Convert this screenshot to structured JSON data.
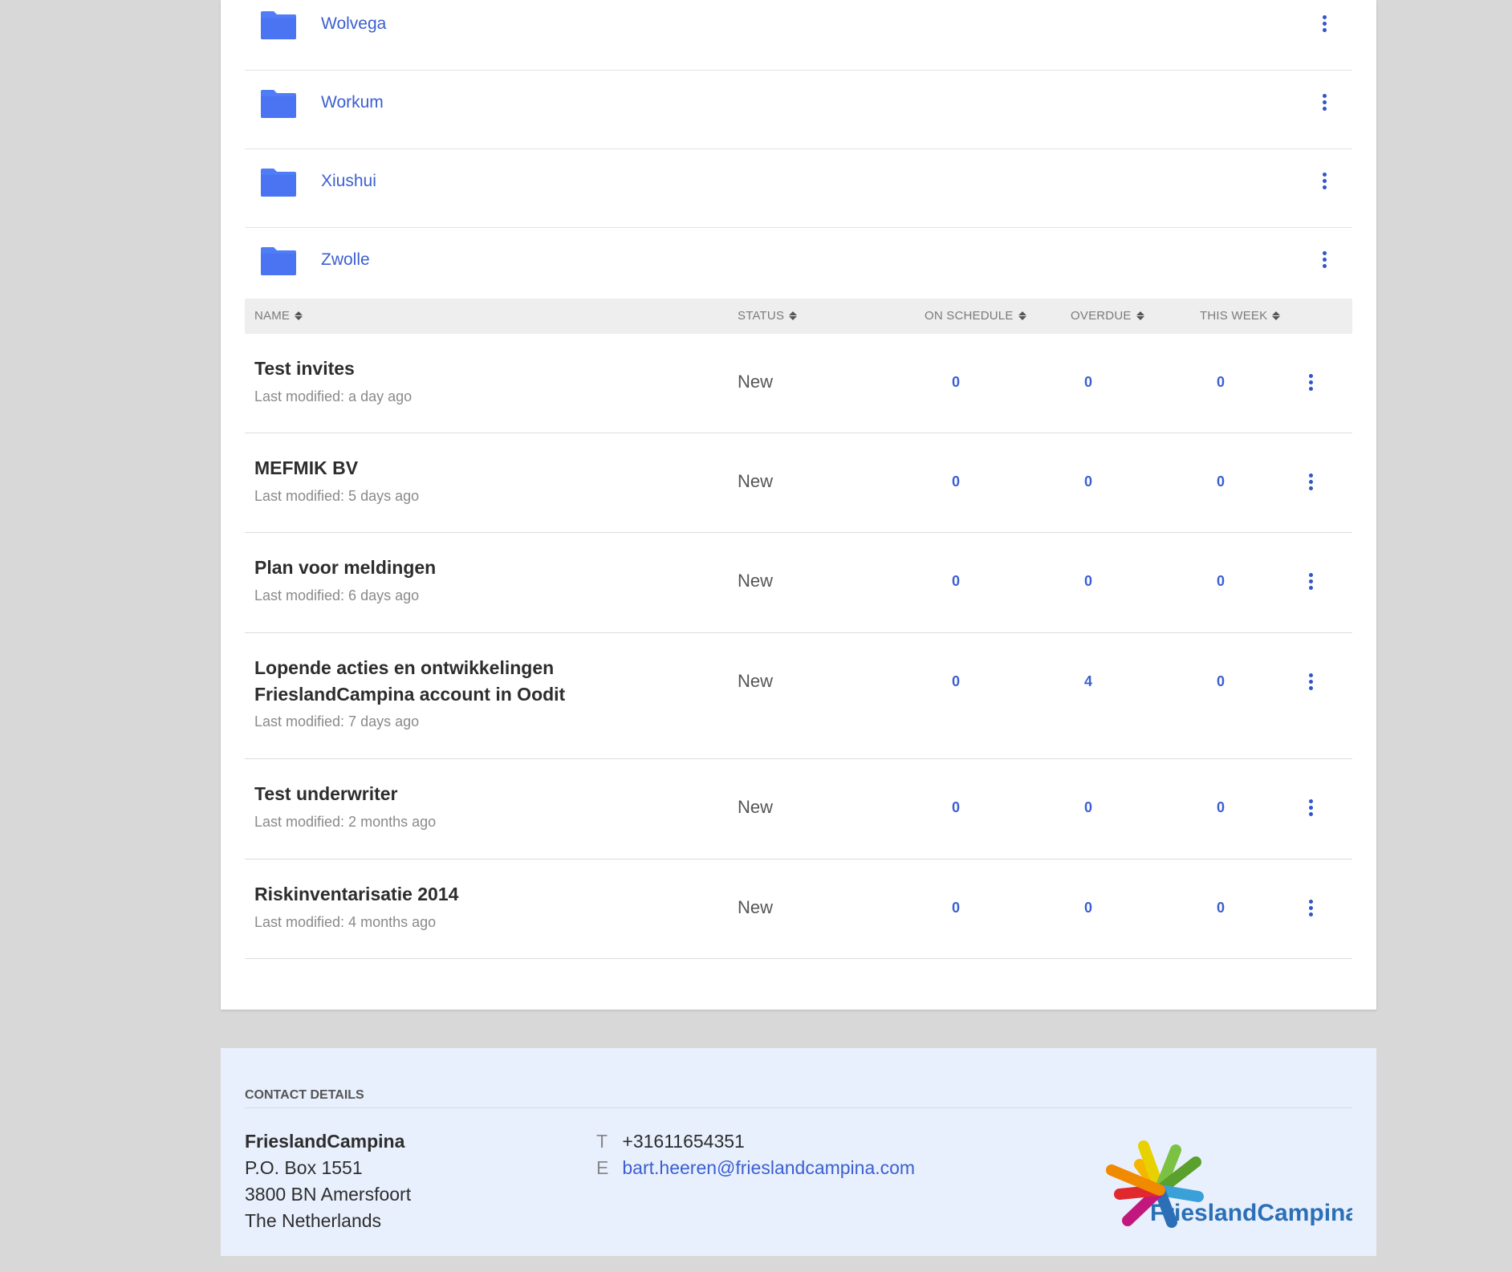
{
  "folders": [
    {
      "name": "Wolvega"
    },
    {
      "name": "Workum"
    },
    {
      "name": "Xiushui"
    },
    {
      "name": "Zwolle"
    }
  ],
  "table": {
    "headers": {
      "name": "NAME",
      "status": "STATUS",
      "on_schedule": "ON SCHEDULE",
      "overdue": "OVERDUE",
      "this_week": "THIS WEEK"
    },
    "rows": [
      {
        "name": "Test invites",
        "modified": "Last modified: a day ago",
        "status": "New",
        "on_schedule": "0",
        "overdue": "0",
        "this_week": "0"
      },
      {
        "name": "MEFMIK BV",
        "modified": "Last modified: 5 days ago",
        "status": "New",
        "on_schedule": "0",
        "overdue": "0",
        "this_week": "0"
      },
      {
        "name": "Plan voor meldingen",
        "modified": "Last modified: 6 days ago",
        "status": "New",
        "on_schedule": "0",
        "overdue": "0",
        "this_week": "0"
      },
      {
        "name": "Lopende acties en ontwikkelingen FrieslandCampina account in Oodit",
        "modified": "Last modified: 7 days ago",
        "status": "New",
        "on_schedule": "0",
        "overdue": "4",
        "this_week": "0"
      },
      {
        "name": "Test underwriter",
        "modified": "Last modified: 2 months ago",
        "status": "New",
        "on_schedule": "0",
        "overdue": "0",
        "this_week": "0"
      },
      {
        "name": "Riskinventarisatie 2014",
        "modified": "Last modified: 4 months ago",
        "status": "New",
        "on_schedule": "0",
        "overdue": "0",
        "this_week": "0"
      }
    ]
  },
  "footer": {
    "title": "CONTACT DETAILS",
    "company": "FrieslandCampina",
    "address_line1": "P.O. Box 1551",
    "address_line2": "3800 BN Amersfoort",
    "address_line3": "The Netherlands",
    "phone_label": "T",
    "phone": "+31611654351",
    "email_label": "E",
    "email": "bart.heeren@frieslandcampina.com",
    "logo_text": "FrieslandCampina"
  },
  "colors": {
    "accent": "#3b5fd0",
    "folder": "#4f7df7",
    "background": "#d8d8d8",
    "footer_bg": "#e9f0fd"
  }
}
